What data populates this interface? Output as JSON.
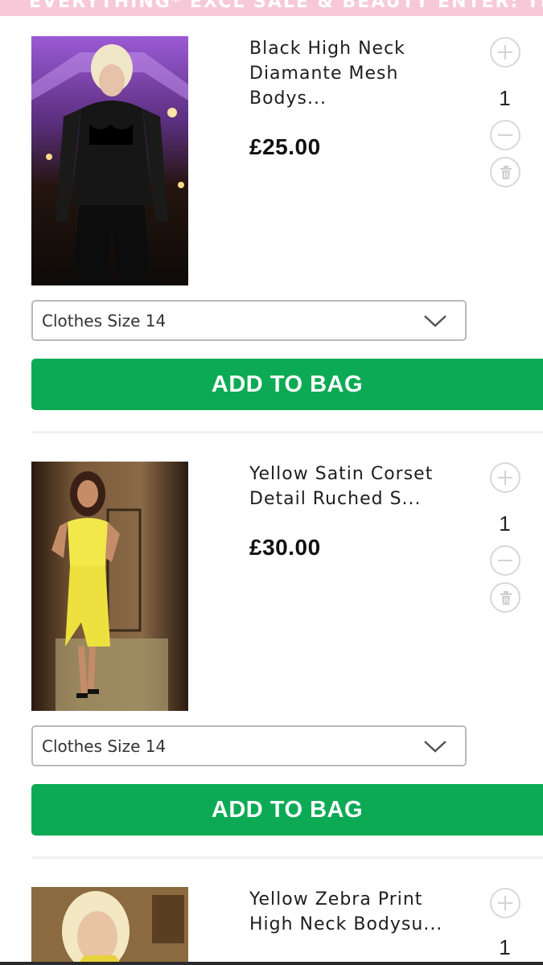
{
  "promo": {
    "text": "EVERYTHING* EXCL SALE & BEAUTY ENTER: TREATME"
  },
  "colors": {
    "banner": "#f7c9d8",
    "add_to_bag": "#0daa55",
    "border": "#b9b9b9"
  },
  "products": [
    {
      "name_line1": "Black High Neck",
      "name_line2": "Diamante Mesh",
      "name_line3": "Bodys...",
      "price": "£25.00",
      "quantity": "1",
      "size": "Clothes Size 14",
      "add_label": "ADD TO BAG",
      "image_icon": "product-photo-black-bodysuit"
    },
    {
      "name_line1": "Yellow Satin Corset",
      "name_line2": "Detail Ruched S...",
      "price": "£30.00",
      "quantity": "1",
      "size": "Clothes Size 14",
      "add_label": "ADD TO BAG",
      "image_icon": "product-photo-yellow-dress"
    },
    {
      "name_line1": "Yellow Zebra Print",
      "name_line2": "High Neck Bodysu...",
      "quantity": "1",
      "image_icon": "product-photo-zebra-bodysuit"
    }
  ]
}
